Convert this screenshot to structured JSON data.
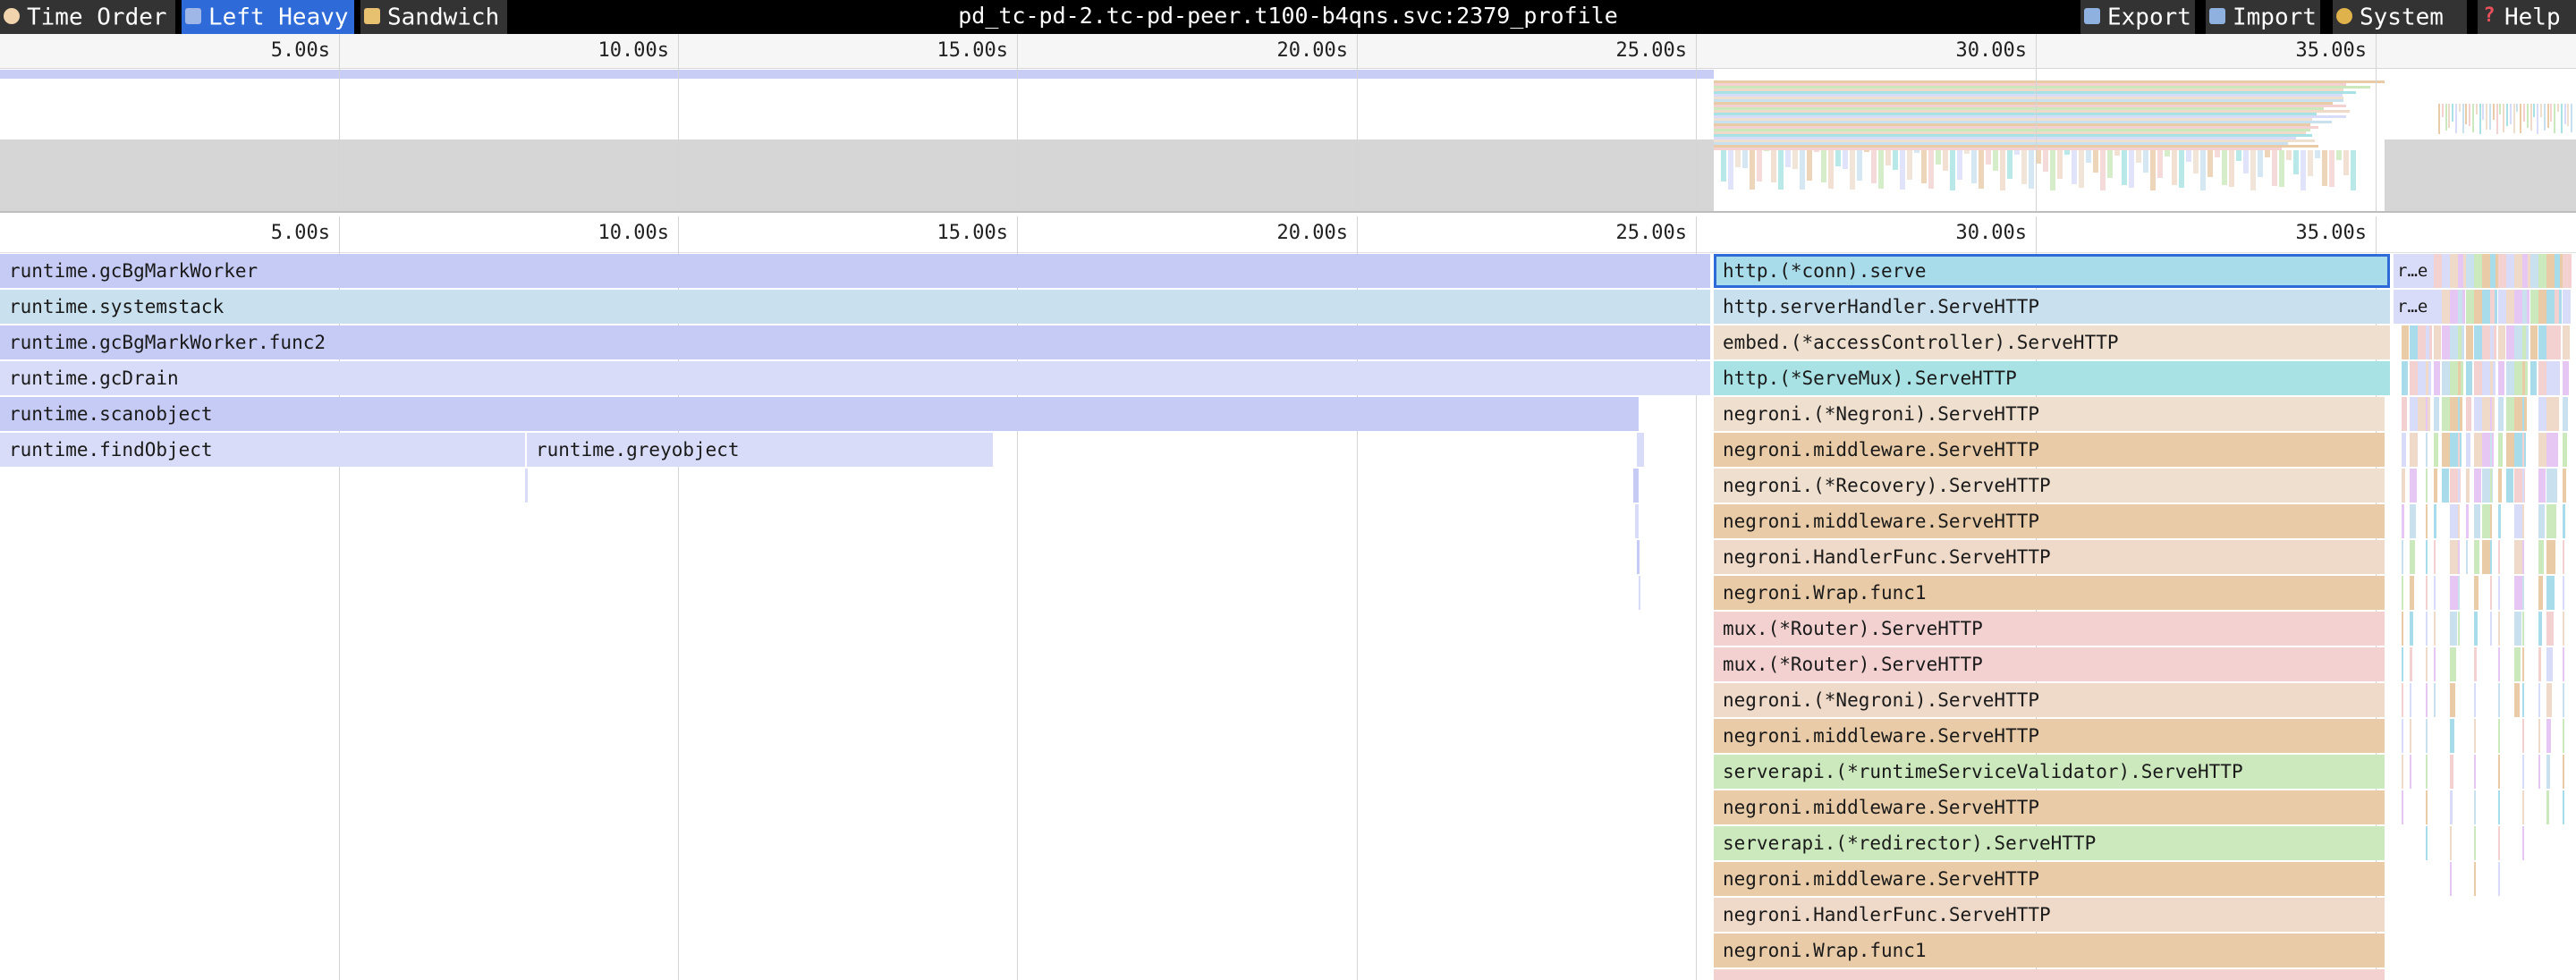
{
  "toolbar": {
    "tabs": [
      {
        "id": "time-order",
        "label": "Time Order",
        "icon": "clock-icon",
        "active": false
      },
      {
        "id": "left-heavy",
        "label": "Left Heavy",
        "icon": "arrow-left-icon",
        "active": true
      },
      {
        "id": "sandwich",
        "label": "Sandwich",
        "icon": "sandwich-icon",
        "active": false
      }
    ],
    "title": "pd_tc-pd-2.tc-pd-peer.t100-b4qns.svc:2379_profile",
    "actions": [
      {
        "id": "export",
        "label": "Export",
        "icon": "export-icon"
      },
      {
        "id": "import",
        "label": "Import",
        "icon": "import-icon"
      },
      {
        "id": "system",
        "label": "System",
        "icon": "palette-icon"
      },
      {
        "id": "help",
        "label": "Help",
        "icon": "question-icon"
      }
    ]
  },
  "axis": {
    "ticks": [
      "5.00s",
      "10.00s",
      "15.00s",
      "20.00s",
      "25.00s",
      "30.00s",
      "35.00s"
    ]
  },
  "flamegraph": {
    "left_stack": [
      "runtime.gcBgMarkWorker",
      "runtime.systemstack",
      "runtime.gcBgMarkWorker.func2",
      "runtime.gcDrain",
      "runtime.scanobject",
      "runtime.findObject",
      "runtime.greyobject"
    ],
    "right_stack": [
      "http.(*conn).serve",
      "http.serverHandler.ServeHTTP",
      "embed.(*accessController).ServeHTTP",
      "http.(*ServeMux).ServeHTTP",
      "negroni.(*Negroni).ServeHTTP",
      "negroni.middleware.ServeHTTP",
      "negroni.(*Recovery).ServeHTTP",
      "negroni.middleware.ServeHTTP",
      "negroni.HandlerFunc.ServeHTTP",
      "negroni.Wrap.func1",
      "mux.(*Router).ServeHTTP",
      "mux.(*Router).ServeHTTP",
      "negroni.(*Negroni).ServeHTTP",
      "negroni.middleware.ServeHTTP",
      "serverapi.(*runtimeServiceValidator).ServeHTTP",
      "negroni.middleware.ServeHTTP",
      "serverapi.(*redirector).ServeHTTP",
      "negroni.middleware.ServeHTTP",
      "negroni.HandlerFunc.ServeHTTP",
      "negroni.Wrap.func1"
    ],
    "truncated_labels": [
      "r…e",
      "r…e",
      "r…"
    ],
    "selected_frame": "http.(*conn).serve"
  },
  "colors": {
    "runtime_blue": "#c5cbf5",
    "runtime_light": "#d8dcf8",
    "runtime_teal": "#c9e1ef",
    "http_blue": "#a9dcea",
    "http_teal": "#a8e2e4",
    "embed_tan": "#eedfcf",
    "negroni_orange": "#e9cba7",
    "negroni_light": "#efd9c8",
    "mux_pink": "#f3d1d1",
    "serverapi_green": "#cce9bd",
    "selection": "#2e6bd8"
  }
}
